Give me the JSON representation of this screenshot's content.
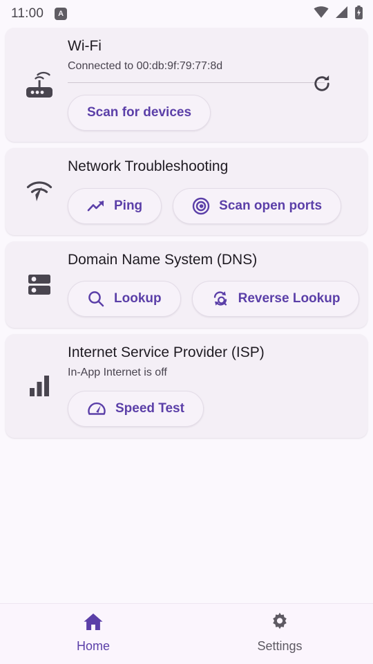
{
  "status_bar": {
    "time": "11:00",
    "app_badge_letter": "A",
    "icons": [
      "wifi-icon",
      "cellular-signal-icon",
      "battery-charging-icon"
    ]
  },
  "theme": {
    "accent": "#5b3fa8",
    "page_background": "#fbf8fd",
    "card_background": "#f4eff6",
    "title_color": "#1f1b22",
    "icon_color": "#49454f"
  },
  "cards": [
    {
      "id": "wifi",
      "icon": "router-icon",
      "title": "Wi-Fi",
      "subtitle": "Connected to 00:db:9f:79:77:8d",
      "has_divider": true,
      "action_icon": "refresh-icon",
      "buttons": [
        {
          "label": "Scan for devices",
          "icon": "none"
        }
      ]
    },
    {
      "id": "network-troubleshooting",
      "icon": "network-check-icon",
      "title": "Network Troubleshooting",
      "subtitle": "",
      "has_divider": false,
      "action_icon": "none",
      "buttons": [
        {
          "label": "Ping",
          "icon": "trending-up-icon"
        },
        {
          "label": "Scan open ports",
          "icon": "target-icon"
        }
      ]
    },
    {
      "id": "dns",
      "icon": "dns-server-icon",
      "title": "Domain Name System (DNS)",
      "subtitle": "",
      "has_divider": false,
      "action_icon": "none",
      "buttons": [
        {
          "label": "Lookup",
          "icon": "search-icon"
        },
        {
          "label": "Reverse Lookup",
          "icon": "reverse-search-icon"
        }
      ]
    },
    {
      "id": "isp",
      "icon": "signal-bars-icon",
      "title": "Internet Service Provider (ISP)",
      "subtitle": "In-App Internet is off",
      "has_divider": false,
      "action_icon": "none",
      "buttons": [
        {
          "label": "Speed Test",
          "icon": "speedometer-icon"
        }
      ]
    }
  ],
  "bottom_nav": {
    "items": [
      {
        "label": "Home",
        "icon": "home-icon",
        "active": true
      },
      {
        "label": "Settings",
        "icon": "gear-icon",
        "active": false
      }
    ]
  }
}
